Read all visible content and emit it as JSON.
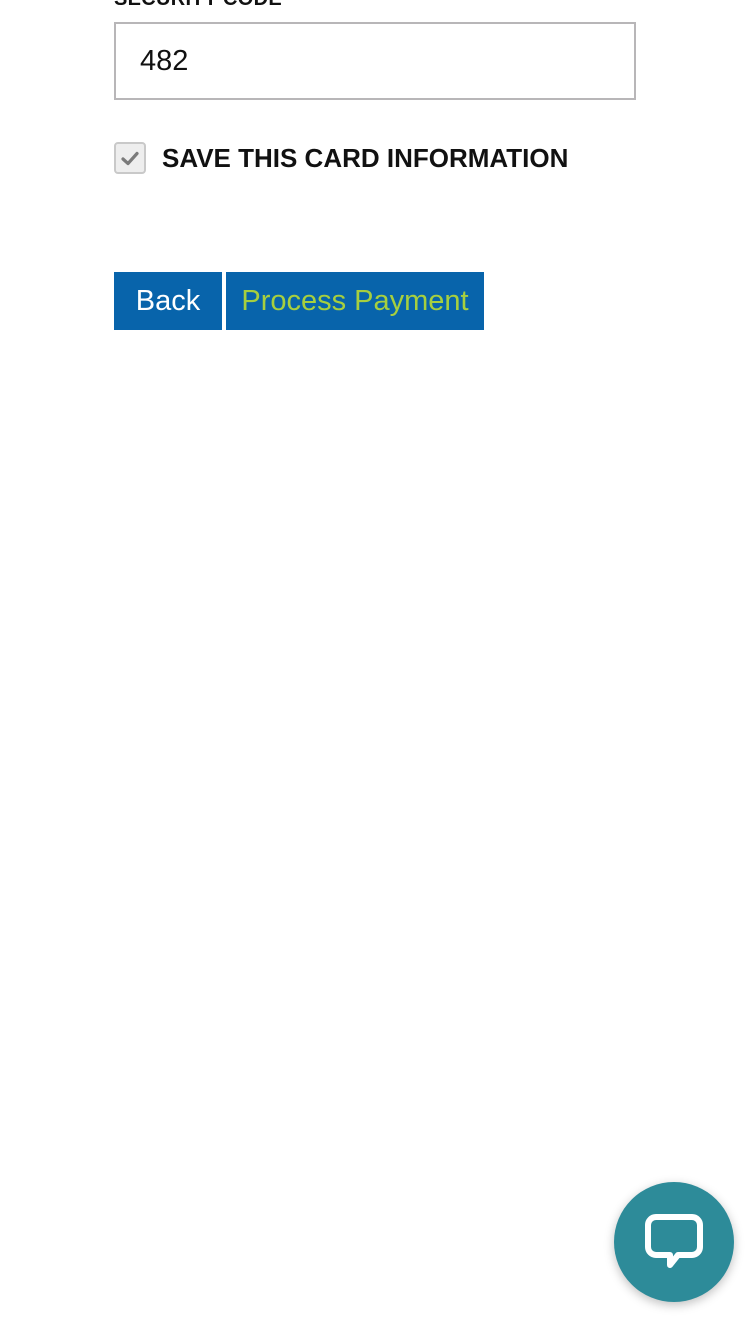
{
  "form": {
    "security_code_label": "SECURITY CODE",
    "security_code_value": "482",
    "save_card_label": "SAVE THIS CARD INFORMATION",
    "save_card_checked": true
  },
  "actions": {
    "back_label": "Back",
    "process_label": "Process Payment"
  },
  "chat": {
    "icon": "chat-bubble-icon"
  },
  "colors": {
    "button_bg": "#0864ab",
    "back_text": "#ffffff",
    "process_text": "#a6cf3f",
    "chat_bg": "#2d8b99",
    "input_border": "#b8b6b8"
  }
}
